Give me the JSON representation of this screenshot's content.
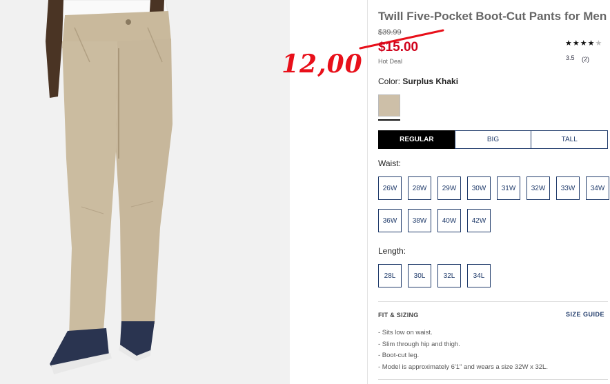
{
  "product": {
    "title": "Twill Five-Pocket Boot-Cut Pants for Men",
    "price_original": "$39.99",
    "price_sale": "$15.00",
    "deal_label": "Hot Deal",
    "rating": {
      "stars_filled": "★★★",
      "stars_half": "★",
      "stars_empty": "★",
      "value": "3.5",
      "count": "(2)"
    },
    "color": {
      "label": "Color:",
      "name": "Surplus Khaki",
      "swatch_color": "#cdbfa8"
    }
  },
  "annotation": {
    "new_price": "12,00",
    "color": "#e8101a"
  },
  "fit_tabs": [
    {
      "label": "REGULAR",
      "active": true
    },
    {
      "label": "BIG",
      "active": false
    },
    {
      "label": "TALL",
      "active": false
    }
  ],
  "waist": {
    "label": "Waist:",
    "sizes": [
      "26W",
      "28W",
      "29W",
      "30W",
      "31W",
      "32W",
      "33W",
      "34W",
      "36W",
      "38W",
      "40W",
      "42W"
    ]
  },
  "length": {
    "label": "Length:",
    "sizes": [
      "28L",
      "30L",
      "32L",
      "34L"
    ]
  },
  "fit_sizing": {
    "heading": "FIT & SIZING",
    "size_guide": "SIZE GUIDE",
    "bullets": [
      "- Sits low on waist.",
      "- Slim through hip and thigh.",
      "- Boot-cut leg.",
      "- Model is approximately 6'1\" and wears a size 32W x 32L."
    ]
  },
  "colors": {
    "brand_navy": "#1f3a6a",
    "sale_red": "#d0021b"
  }
}
